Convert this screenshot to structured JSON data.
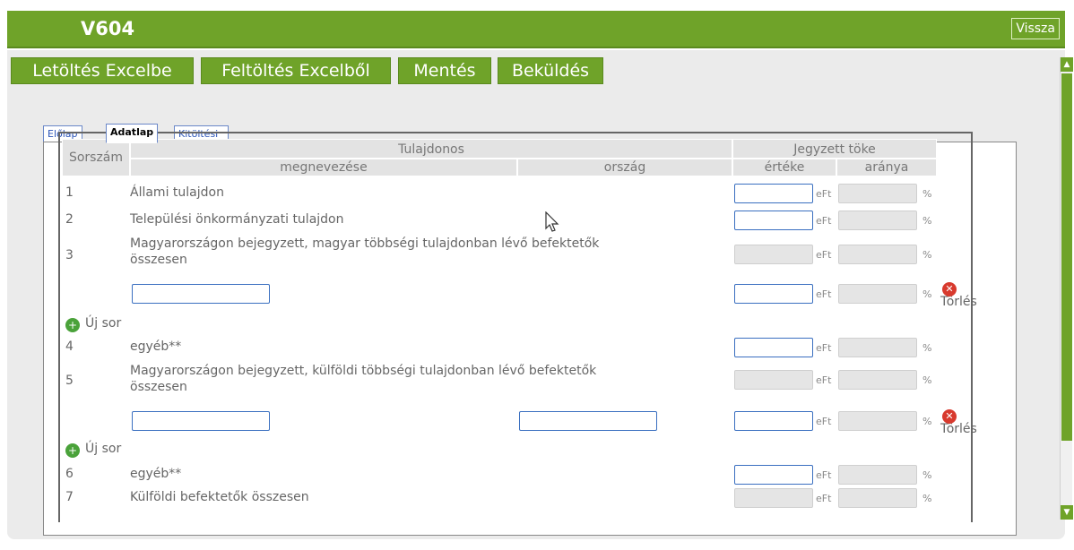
{
  "header": {
    "title": "V604",
    "back_label": "Vissza"
  },
  "toolbar": {
    "download_label": "Letöltés Excelbe",
    "upload_label": "Feltöltés Excelből",
    "save_label": "Mentés",
    "send_label": "Beküldés"
  },
  "tabs": [
    {
      "label": "Előlap",
      "active": false
    },
    {
      "label": "Adatlap",
      "active": true
    },
    {
      "label": "Kitöltési útmutató",
      "active": false
    }
  ],
  "table": {
    "headers": {
      "sorszam": "Sorszám",
      "tulajdonos": "Tulajdonos",
      "megnevezese": "megnevezése",
      "orszag": "ország",
      "jegyzett_toke": "Jegyzett töke",
      "erteke": "értéke",
      "aranya": "aránya"
    },
    "rows": [
      {
        "num": "1",
        "name": "Állami tulajdon"
      },
      {
        "num": "2",
        "name": "Települési önkormányzati tulajdon"
      },
      {
        "num": "3",
        "name": "Magyarországon bejegyzett, magyar többségi tulajdonban lévő befektetők",
        "name2": "összesen"
      },
      {
        "num": "4",
        "name": "egyéb**"
      },
      {
        "num": "5",
        "name": "Magyarországon bejegyzett, külföldi többségi tulajdonban lévő befektetők",
        "name2": "összesen"
      },
      {
        "num": "6",
        "name": "egyéb**"
      },
      {
        "num": "7",
        "name": "Külföldi befektetők összesen"
      }
    ],
    "unit_eft": "eFt",
    "unit_pct": "%",
    "delete_label": "Törlés",
    "new_row_label": "Új sor"
  },
  "colors": {
    "accent": "#6fa329",
    "link": "#2b54b8",
    "input_border": "#3a6fc0"
  }
}
